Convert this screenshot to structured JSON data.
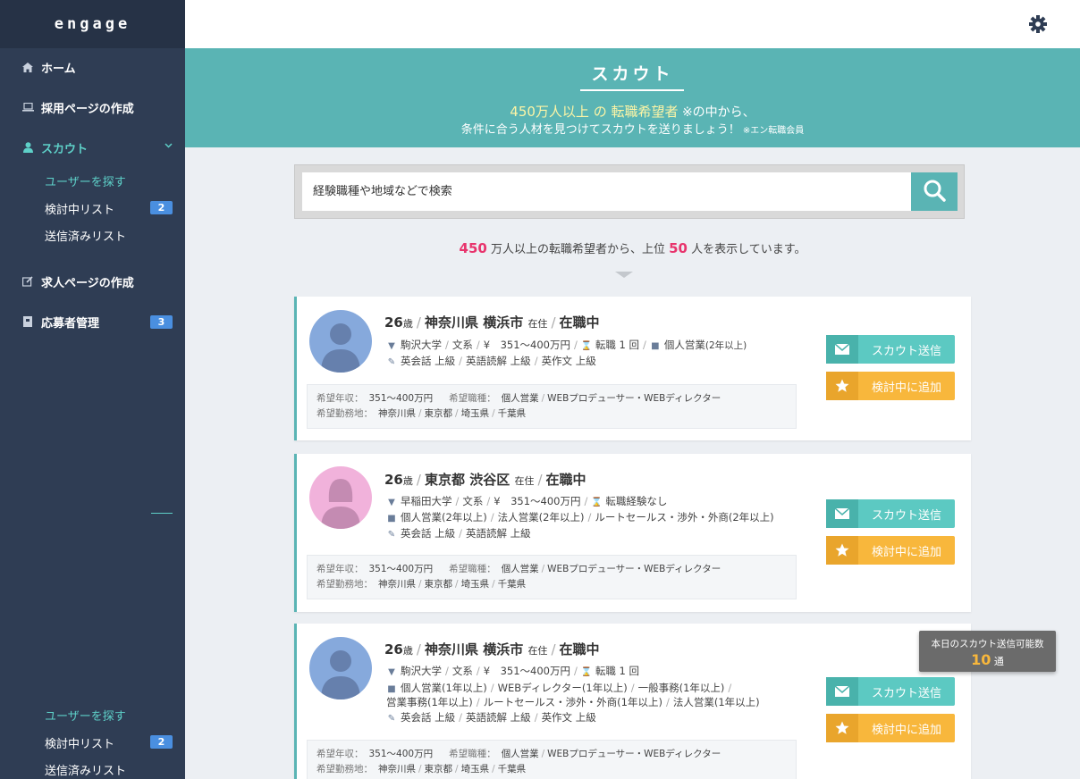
{
  "app": {
    "logo": "engage",
    "settings_icon": "gear-icon"
  },
  "sidebar": {
    "nav": [
      {
        "label": "ホーム",
        "icon": "home-icon"
      },
      {
        "label": "採用ページの作成",
        "icon": "laptop-icon"
      },
      {
        "label": "スカウト",
        "icon": "user-icon"
      },
      {
        "label": "求人ページの作成",
        "icon": "edit-icon"
      },
      {
        "label": "応募者管理",
        "icon": "inbox-icon",
        "badge": "3"
      }
    ],
    "scout_sub": [
      {
        "label": "ユーザーを探す"
      },
      {
        "label": "検討中リスト",
        "badge": "2"
      },
      {
        "label": "送信済みリスト"
      }
    ],
    "bottom_sub": [
      {
        "label": "ユーザーを探す"
      },
      {
        "label": "検討中リスト",
        "badge": "2"
      },
      {
        "label": "送信済みリスト"
      }
    ]
  },
  "hero": {
    "title": "スカウト",
    "line1_a": "450万人以上",
    "line1_b": " の ",
    "line1_c": "転職希望者",
    "line1_note": " ※の中から、",
    "line2": "条件に合う人材を見つけてスカウトを送りましょう！",
    "line2_note": " ※エン転職会員"
  },
  "search": {
    "placeholder": "経験職種や地域などで検索",
    "icon": "search-icon"
  },
  "result": {
    "prefix_num": "450",
    "text1": " 万人以上の転職希望者から、上位 ",
    "top_num": "50",
    "text2": " 人を表示しています。"
  },
  "buttons": {
    "scout": "スカウト送信",
    "review": "検討中に追加"
  },
  "desire_labels": {
    "salary": "希望年収：",
    "job": "希望職種：",
    "area": "希望勤務地："
  },
  "cards": [
    {
      "age": "26",
      "age_unit": "歳",
      "pref": "神奈川県",
      "city": "横浜市",
      "live": "在住",
      "status": "在職中",
      "edu": "駒沢大学",
      "field": "文系",
      "salary_now": "¥　351～400万円",
      "jobchange": "転職 1 回",
      "job": "個人営業",
      "job_note": "(2年以上)",
      "lang": [
        "英会話 上級",
        "英語読解 上級",
        "英作文 上級"
      ],
      "d_salary": "351～400万円",
      "d_jobs": [
        "個人営業",
        "WEBプロデューサー・WEBディレクター"
      ],
      "d_areas": [
        "神奈川県",
        "東京都",
        "埼玉県",
        "千葉県"
      ]
    },
    {
      "age": "26",
      "age_unit": "歳",
      "pref": "東京都",
      "city": "渋谷区",
      "live": "在住",
      "status": "在職中",
      "edu": "早稲田大学",
      "field": "文系",
      "salary_now": "¥　351～400万円",
      "jobchange": "転職経験なし",
      "jobs_line": [
        "個人営業(2年以上)",
        "法人営業(2年以上)",
        "ルートセールス・渉外・外商(2年以上)"
      ],
      "lang": [
        "英会話 上級",
        "英語読解 上級"
      ],
      "d_salary": "351～400万円",
      "d_jobs": [
        "個人営業",
        "WEBプロデューサー・WEBディレクター"
      ],
      "d_areas": [
        "神奈川県",
        "東京都",
        "埼玉県",
        "千葉県"
      ]
    },
    {
      "age": "26",
      "age_unit": "歳",
      "pref": "神奈川県",
      "city": "横浜市",
      "live": "在住",
      "status": "在職中",
      "edu": "駒沢大学",
      "field": "文系",
      "salary_now": "¥　351～400万円",
      "jobchange": "転職 1 回",
      "jobs_line1": [
        "個人営業(1年以上)",
        "WEBディレクター(1年以上)",
        "一般事務(1年以上)",
        ""
      ],
      "jobs_line2": [
        "営業事務(1年以上)",
        "ルートセールス・渉外・外商(1年以上)",
        "法人営業(1年以上)"
      ],
      "lang": [
        "英会話 上級",
        "英語読解 上級",
        "英作文 上級"
      ],
      "d_salary": "351～400万円",
      "d_jobs": [
        "個人営業",
        "WEBプロデューサー・WEBディレクター"
      ],
      "d_areas": [
        "神奈川県",
        "東京都",
        "埼玉県",
        "千葉県"
      ]
    }
  ],
  "quota": {
    "label": "本日のスカウト送信可能数",
    "count": "10",
    "unit": "通"
  }
}
